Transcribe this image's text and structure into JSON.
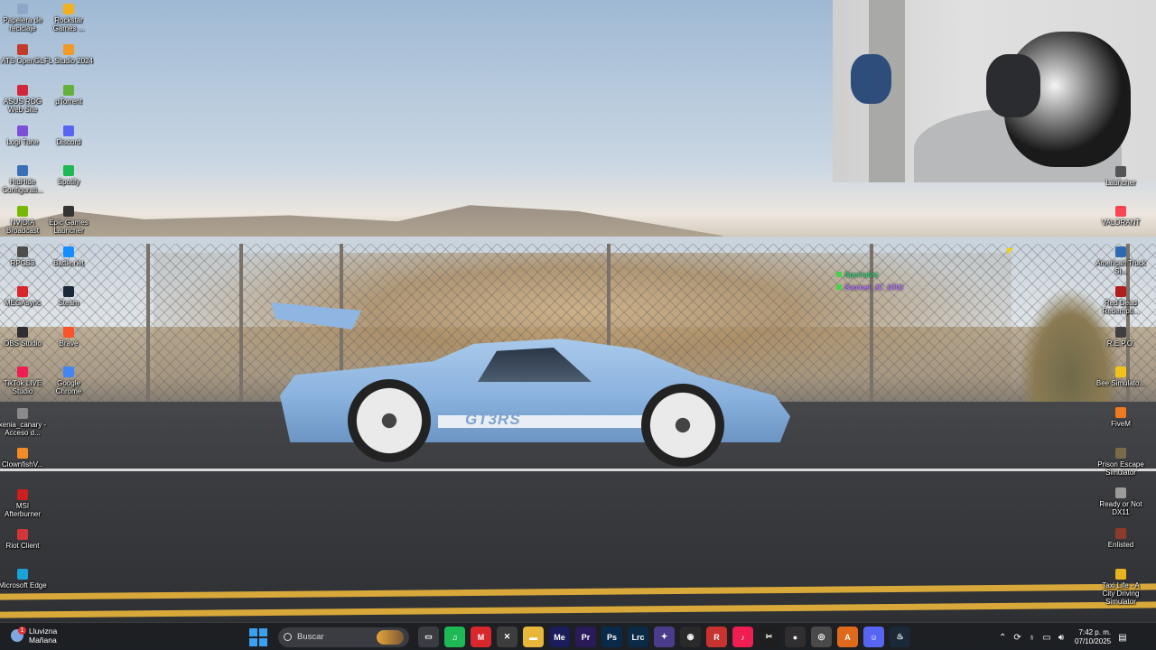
{
  "left_icons": [
    {
      "name": "recycle-bin",
      "label": "Papelera de reciclaje",
      "color": "#8fa7c7"
    },
    {
      "name": "rockstar-games",
      "label": "Rockstar Games ...",
      "color": "#f0b020"
    },
    {
      "name": "ats-opengl",
      "label": "ATS OpenGL",
      "color": "#c23a2a"
    },
    {
      "name": "fl-studio",
      "label": "FL Studio 2024",
      "color": "#f29a27"
    },
    {
      "name": "asus-rog",
      "label": "ASUS ROG Web Site",
      "color": "#d0283a"
    },
    {
      "name": "utorrent",
      "label": "µTorrent",
      "color": "#63b03a"
    },
    {
      "name": "logi-tune",
      "label": "Logi Tune",
      "color": "#7b4fd6"
    },
    {
      "name": "discord",
      "label": "Discord",
      "color": "#5865f2"
    },
    {
      "name": "hidhide",
      "label": "HidHide Configurati...",
      "color": "#3b6fb5"
    },
    {
      "name": "spotify",
      "label": "Spotify",
      "color": "#1db954"
    },
    {
      "name": "nvidia-broadcast",
      "label": "NVIDIA Broadcast",
      "color": "#76b900"
    },
    {
      "name": "epic-games",
      "label": "Epic Games Launcher",
      "color": "#333333"
    },
    {
      "name": "rpcs3",
      "label": "RPCS3",
      "color": "#4d4d4d"
    },
    {
      "name": "battlenet",
      "label": "Battle.net",
      "color": "#148eff"
    },
    {
      "name": "megasync",
      "label": "MEGAsync",
      "color": "#d9272e"
    },
    {
      "name": "steam",
      "label": "Steam",
      "color": "#1b2838"
    },
    {
      "name": "obs-studio",
      "label": "OBS Studio",
      "color": "#302e31"
    },
    {
      "name": "brave",
      "label": "Brave",
      "color": "#fb542b"
    },
    {
      "name": "tiktok-live-studio",
      "label": "TikTok LIVE Studio",
      "color": "#ee1d52"
    },
    {
      "name": "google-chrome",
      "label": "Google Chrome",
      "color": "#4285f4"
    },
    {
      "name": "xenia-canary",
      "label": "xenia_canary - Acceso d...",
      "color": "#8a8a8a"
    },
    {
      "name": "clownfish",
      "label": "ClownfishV...",
      "color": "#f28c28"
    },
    {
      "name": "msi-afterburner",
      "label": "MSI Afterburner",
      "color": "#cc1f1f"
    },
    {
      "name": "riot-client",
      "label": "Riot Client",
      "color": "#d13639"
    },
    {
      "name": "microsoft-edge",
      "label": "Microsoft Edge",
      "color": "#1aa2d9"
    }
  ],
  "right_icons": [
    {
      "name": "launcher",
      "label": "Launcher",
      "color": "#555555"
    },
    {
      "name": "valorant",
      "label": "VALORANT",
      "color": "#fa4454"
    },
    {
      "name": "american-truck-sim",
      "label": "American Truck Si...",
      "color": "#2d6ab1"
    },
    {
      "name": "red-dead-redemption",
      "label": "Red Dead Redempti...",
      "color": "#b01e1e"
    },
    {
      "name": "repo",
      "label": "R.E.P.O.",
      "color": "#3f3f3f"
    },
    {
      "name": "bee-simulator",
      "label": "Bee Simulato...",
      "color": "#f2c21b"
    },
    {
      "name": "fivem",
      "label": "FiveM",
      "color": "#f07b1e"
    },
    {
      "name": "prison-escape-simulator",
      "label": "Prison Escape Simulator",
      "color": "#7a6a4a"
    },
    {
      "name": "ready-or-not",
      "label": "Ready or Not DX11",
      "color": "#9b9b9b"
    },
    {
      "name": "enlisted",
      "label": "Enlisted",
      "color": "#8c3b2a"
    },
    {
      "name": "taxi-life",
      "label": "Taxi Life - A City Driving Simulator",
      "color": "#e6b31c"
    }
  ],
  "chat": {
    "user1": "Specialist",
    "msg1": "· · · · · · · · · · · · ·",
    "user2": "Samuel_JC_0303",
    "msg2": "· · · · · · · · · ·"
  },
  "car_text": "GT3RS",
  "taskbar": {
    "weather_label": "Lluvizna",
    "weather_sub": "Mañana",
    "weather_badge": "1",
    "search_placeholder": "Buscar",
    "apps": [
      {
        "name": "task-view",
        "glyph": "▭",
        "color": "#3a3c41"
      },
      {
        "name": "spotify",
        "glyph": "♫",
        "color": "#1db954"
      },
      {
        "name": "megasync",
        "glyph": "M",
        "color": "#d9272e"
      },
      {
        "name": "xbox",
        "glyph": "✕",
        "color": "#3d3d3d"
      },
      {
        "name": "file-explorer",
        "glyph": "▬",
        "color": "#e8b73a"
      },
      {
        "name": "media-encoder",
        "glyph": "Me",
        "color": "#1a1d5a"
      },
      {
        "name": "premiere-pro",
        "glyph": "Pr",
        "color": "#2a1a5a"
      },
      {
        "name": "photoshop",
        "glyph": "Ps",
        "color": "#0a2a4a"
      },
      {
        "name": "lightroom-classic",
        "glyph": "Lrc",
        "color": "#0b2a45"
      },
      {
        "name": "gamepad",
        "glyph": "✦",
        "color": "#4a3c8a"
      },
      {
        "name": "capture",
        "glyph": "◉",
        "color": "#2a2a2a"
      },
      {
        "name": "rockstar-launcher",
        "glyph": "R",
        "color": "#c8332f"
      },
      {
        "name": "tiktok",
        "glyph": "♪",
        "color": "#ee1d52"
      },
      {
        "name": "capcut",
        "glyph": "✂",
        "color": "#1e1e1e"
      },
      {
        "name": "obs",
        "glyph": "●",
        "color": "#302e31"
      },
      {
        "name": "chrome",
        "glyph": "◎",
        "color": "#4a4a4a"
      },
      {
        "name": "adobe-acrobat",
        "glyph": "A",
        "color": "#e06a1b"
      },
      {
        "name": "discord",
        "glyph": "☺",
        "color": "#5865f2"
      },
      {
        "name": "steam",
        "glyph": "♨",
        "color": "#1b2838"
      }
    ],
    "time": "7:42 p. m.",
    "date": "07/10/2025"
  }
}
